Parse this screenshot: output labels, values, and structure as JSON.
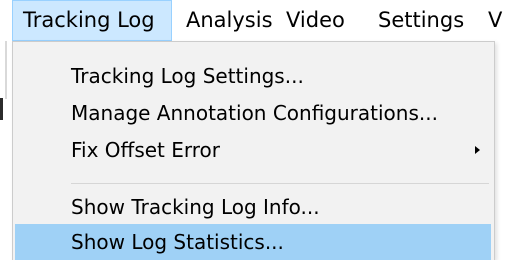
{
  "menubar": {
    "items": [
      {
        "label": "Tracking Log",
        "open": true
      },
      {
        "label": "Analysis"
      },
      {
        "label": "Video"
      },
      {
        "label": "Settings"
      },
      {
        "label": "V"
      }
    ]
  },
  "dropdown": {
    "items": [
      {
        "label": "Tracking Log Settings..."
      },
      {
        "label": "Manage Annotation Configurations..."
      },
      {
        "label": "Fix Offset Error",
        "submenu": true
      },
      {
        "label": "Show Tracking Log Info..."
      },
      {
        "label": "Show Log Statistics...",
        "highlighted": true
      }
    ]
  },
  "colors": {
    "menubar_open_bg": "#cce8ff",
    "dropdown_bg": "#f2f2f2",
    "highlight_bg": "#9fd1f6"
  }
}
